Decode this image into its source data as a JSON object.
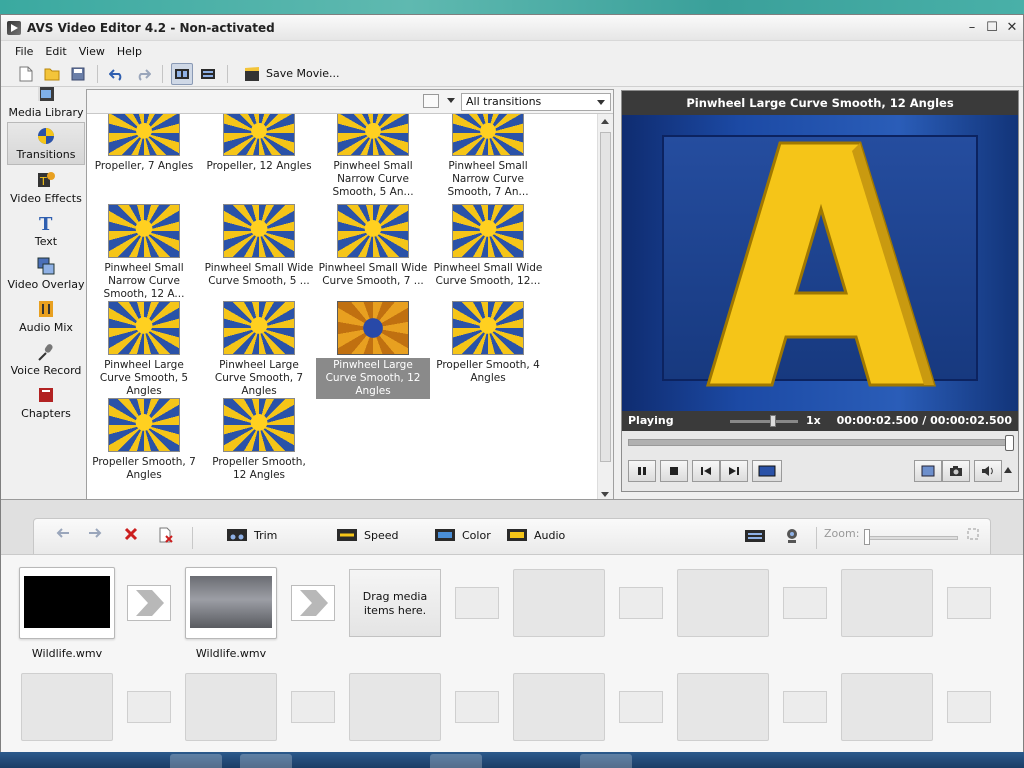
{
  "window": {
    "title": "AVS Video Editor 4.2 - Non-activated"
  },
  "menu": [
    "File",
    "Edit",
    "View",
    "Help"
  ],
  "toolbar": {
    "save_movie": "Save Movie..."
  },
  "sidebar": [
    {
      "label": "Media Library",
      "icon": "film-icon"
    },
    {
      "label": "Transitions",
      "icon": "transitions-icon",
      "active": true
    },
    {
      "label": "Video Effects",
      "icon": "video-effects-icon"
    },
    {
      "label": "Text",
      "icon": "text-icon"
    },
    {
      "label": "Video Overlay",
      "icon": "video-overlay-icon"
    },
    {
      "label": "Audio Mix",
      "icon": "audio-mix-icon"
    },
    {
      "label": "Voice Record",
      "icon": "microphone-icon"
    },
    {
      "label": "Chapters",
      "icon": "chapters-icon"
    }
  ],
  "browser": {
    "filter": "All transitions",
    "items": [
      {
        "label": "Propeller, 7 Angles"
      },
      {
        "label": "Propeller, 12 Angles"
      },
      {
        "label": "Pinwheel Small Narrow Curve Smooth, 5 An..."
      },
      {
        "label": "Pinwheel Small Narrow Curve Smooth, 7 An..."
      },
      {
        "label": "Pinwheel Small Narrow Curve Smooth, 12 A..."
      },
      {
        "label": "Pinwheel Small Wide Curve Smooth, 5 ..."
      },
      {
        "label": "Pinwheel Small Wide Curve Smooth, 7 ..."
      },
      {
        "label": "Pinwheel Small Wide Curve Smooth, 12..."
      },
      {
        "label": "Pinwheel Large Curve Smooth, 5 Angles"
      },
      {
        "label": "Pinwheel Large Curve Smooth, 7 Angles"
      },
      {
        "label": "Pinwheel Large Curve Smooth, 12 Angles",
        "selected": true
      },
      {
        "label": "Propeller Smooth, 4 Angles"
      },
      {
        "label": "Propeller Smooth, 7 Angles"
      },
      {
        "label": "Propeller Smooth, 12 Angles"
      }
    ]
  },
  "preview": {
    "title": "Pinwheel Large Curve Smooth, 12 Angles",
    "status": "Playing",
    "speed": "1x",
    "timecode": "00:00:02.500  /  00:00:02.500",
    "progress": 1.0,
    "letter": "A"
  },
  "timeline_tools": {
    "trim": "Trim",
    "speed": "Speed",
    "color": "Color",
    "audio": "Audio",
    "zoom": "Zoom:"
  },
  "storyboard": {
    "clips": [
      {
        "name": "Wildlife.wmv"
      },
      {
        "name": "Wildlife.wmv"
      }
    ],
    "drag_hint": "Drag media items here."
  },
  "colors": {
    "accent_blue": "#2a52a8",
    "accent_yellow": "#f5c518",
    "preview_header": "#3a3a3a"
  }
}
